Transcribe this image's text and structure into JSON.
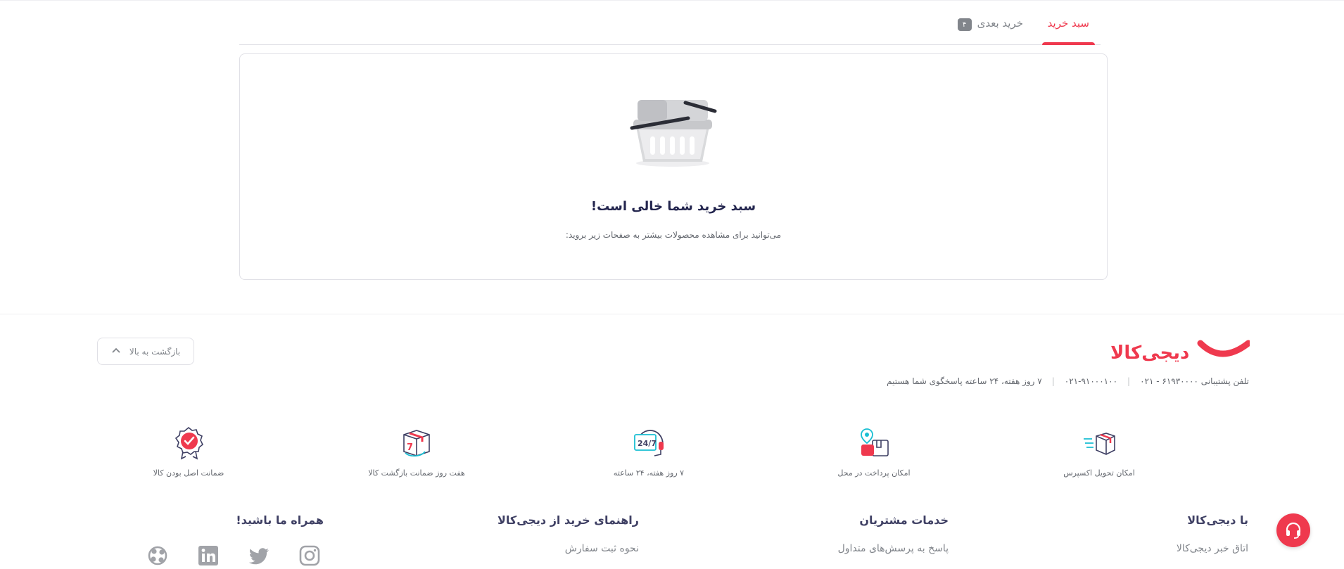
{
  "tabs": [
    {
      "label": "سبد خرید",
      "active": true
    },
    {
      "label": "خرید بعدی",
      "badge": "۴",
      "active": false
    }
  ],
  "empty_cart": {
    "title": "سبد خرید شما خالی است!",
    "subtitle": "می‌توانید برای مشاهده محصولات بیشتر به صفحات زیر بروید:"
  },
  "footer": {
    "logo_text": "دیجی‌کالا",
    "back_to_top": "بازگشت به بالا",
    "contact": {
      "support_phone": "تلفن پشتیبانی ۶۱۹۳۰۰۰۰ - ۰۲۱",
      "alt_phone": "۰۲۱-۹۱۰۰۰۱۰۰",
      "hours": "۷ روز هفته، ۲۴ ساعته پاسخگوی شما هستیم"
    },
    "features": [
      {
        "label": "امکان تحویل اکسپرس",
        "icon": "express-delivery-icon"
      },
      {
        "label": "امکان پرداخت در محل",
        "icon": "cash-on-delivery-icon"
      },
      {
        "label": "۷ روز هفته، ۲۴ ساعته",
        "icon": "support-24-7-icon"
      },
      {
        "label": "هفت روز ضمانت بازگشت کالا",
        "icon": "return-guarantee-icon"
      },
      {
        "label": "ضمانت اصل بودن کالا",
        "icon": "original-guarantee-icon"
      }
    ],
    "columns": [
      {
        "title": "با دیجی‌کالا",
        "link": "اتاق خبر دیجی‌کالا"
      },
      {
        "title": "خدمات مشتریان",
        "link": "پاسخ به پرسش‌های متداول"
      },
      {
        "title": "راهنمای خرید از دیجی‌کالا",
        "link": "نحوه ثبت سفارش"
      },
      {
        "title": "همراه ما باشید!"
      }
    ],
    "social": [
      "instagram-icon",
      "twitter-icon",
      "linkedin-icon",
      "aparat-icon"
    ]
  },
  "colors": {
    "brand": "#ef394e",
    "text_dark": "#23254e",
    "text_muted": "#81858b"
  }
}
